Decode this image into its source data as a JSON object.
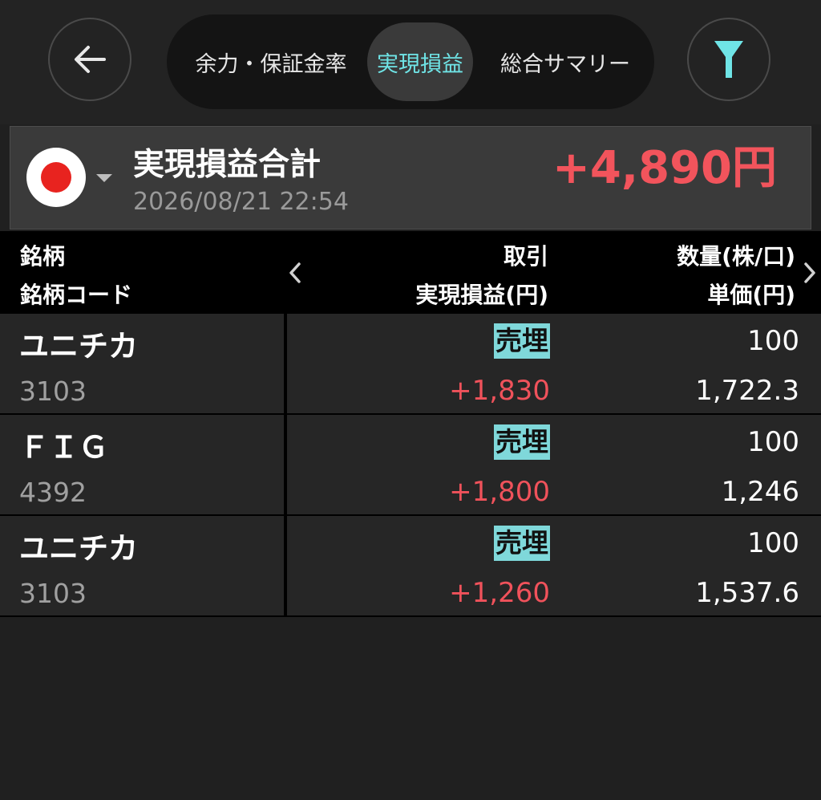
{
  "header": {
    "back_icon": "arrow-left-icon",
    "filter_icon": "filter-funnel-icon",
    "tabs": [
      {
        "label": "余力・保証金率",
        "active": false
      },
      {
        "label": "実現損益",
        "active": true
      },
      {
        "label": "総合サマリー",
        "active": false
      }
    ],
    "active_tab_color": "#6fe4e6",
    "filter_icon_color": "#6fe4e6"
  },
  "summary": {
    "flag_icon": "japan-flag-icon",
    "title": "実現損益合計",
    "timestamp": "2026/08/21 22:54",
    "total": "+4,890円",
    "total_color": "#f2545c"
  },
  "columns": {
    "left_line1": "銘柄",
    "left_line2": "銘柄コード",
    "mid_line1": "取引",
    "mid_line2": "実現損益(円)",
    "right_line1": "数量(株/口)",
    "right_line2": "単価(円)"
  },
  "rows": [
    {
      "name": "ユニチカ",
      "code": "3103",
      "trade": "売埋",
      "pnl": "+1,830",
      "qty": "100",
      "price": "1,722.3"
    },
    {
      "name": "ＦＩＧ",
      "code": "4392",
      "trade": "売埋",
      "pnl": "+1,800",
      "qty": "100",
      "price": "1,246"
    },
    {
      "name": "ユニチカ",
      "code": "3103",
      "trade": "売埋",
      "pnl": "+1,260",
      "qty": "100",
      "price": "1,537.6"
    }
  ],
  "colors": {
    "profit": "#f0525b",
    "badge_bg": "#7fd8da"
  }
}
